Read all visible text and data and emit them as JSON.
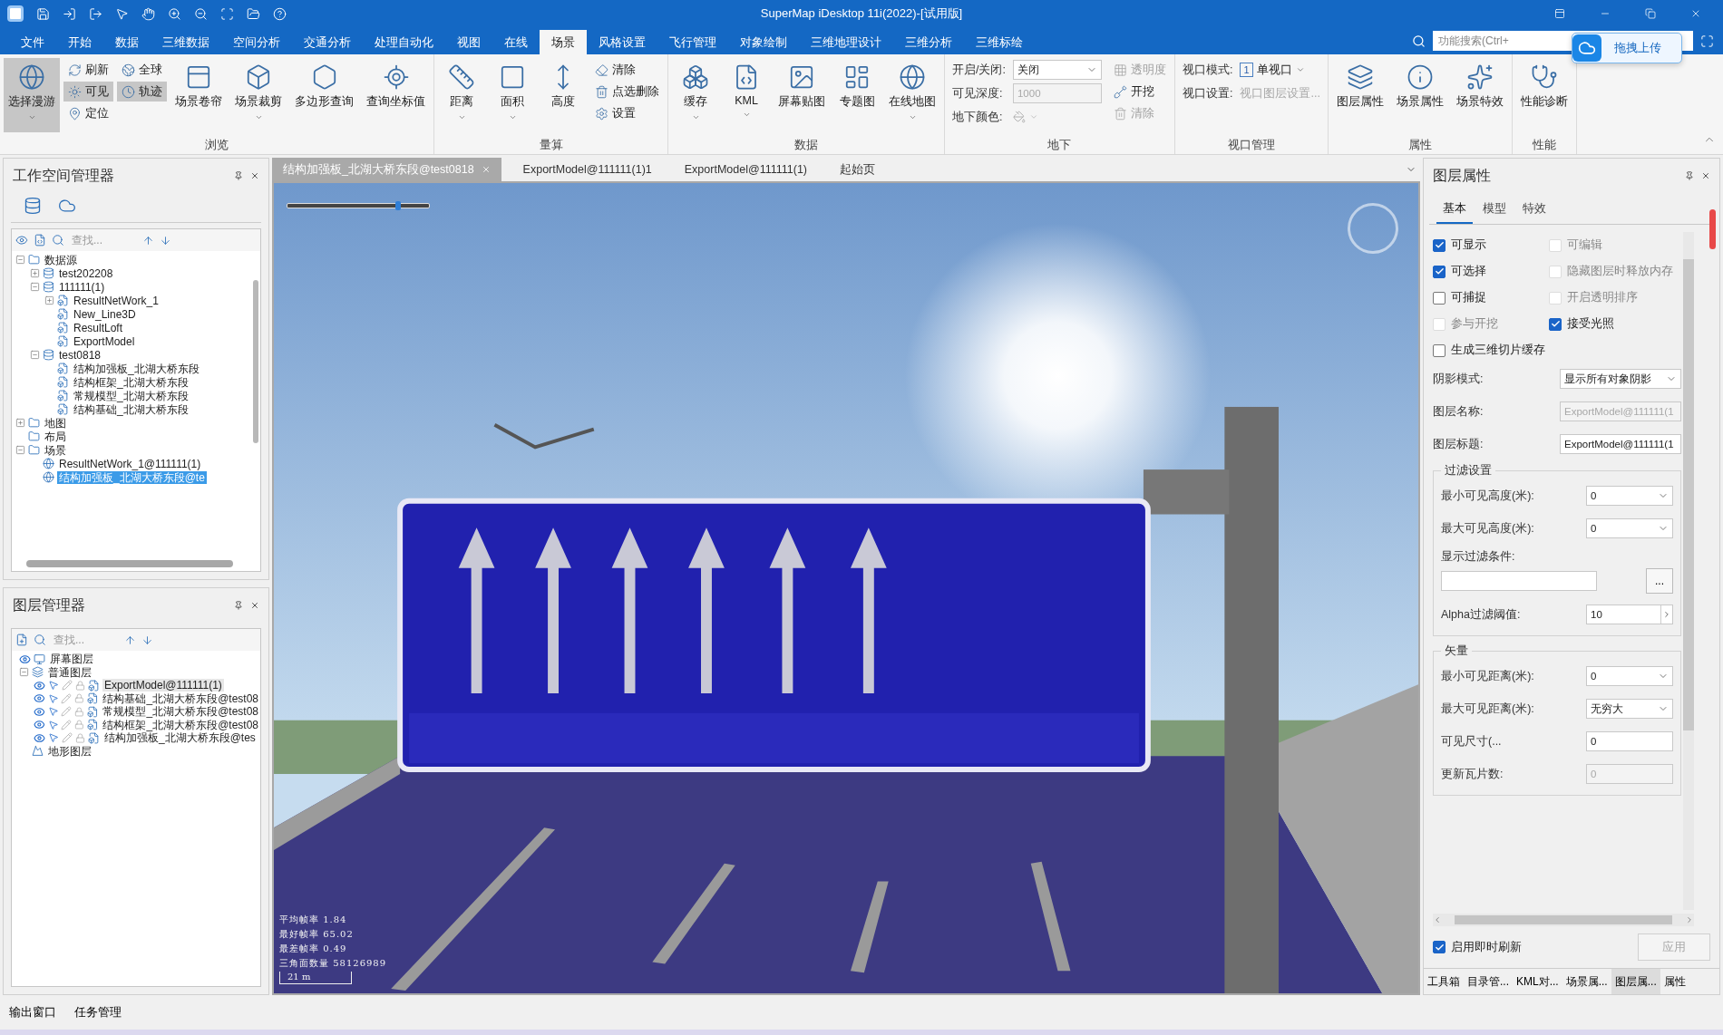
{
  "window": {
    "title": "SuperMap iDesktop 11i(2022)-[试用版]"
  },
  "menu_tabs": [
    {
      "label": "文件",
      "selected": false
    },
    {
      "label": "开始",
      "selected": false
    },
    {
      "label": "数据",
      "selected": false
    },
    {
      "label": "三维数据",
      "selected": false
    },
    {
      "label": "空间分析",
      "selected": false
    },
    {
      "label": "交通分析",
      "selected": false
    },
    {
      "label": "处理自动化",
      "selected": false
    },
    {
      "label": "视图",
      "selected": false
    },
    {
      "label": "在线",
      "selected": false
    },
    {
      "label": "场景",
      "selected": true
    },
    {
      "label": "风格设置",
      "selected": false
    },
    {
      "label": "飞行管理",
      "selected": false
    },
    {
      "label": "对象绘制",
      "selected": false
    },
    {
      "label": "三维地理设计",
      "selected": false
    },
    {
      "label": "三维分析",
      "selected": false
    },
    {
      "label": "三维标绘",
      "selected": false
    }
  ],
  "search": {
    "placeholder": "功能搜索(Ctrl+"
  },
  "upload_popup": {
    "label": "拖拽上传"
  },
  "ribbon": [
    {
      "label": "浏览",
      "items": [
        {
          "kind": "large",
          "label": "选择漫游",
          "highlighted": true,
          "dropdown": true
        },
        {
          "kind": "stack",
          "items": [
            {
              "label": "刷新",
              "highlighted": false,
              "disabled": false
            },
            {
              "label": "可见",
              "highlighted": true,
              "disabled": false
            },
            {
              "label": "定位",
              "highlighted": false,
              "disabled": false
            }
          ]
        },
        {
          "kind": "stack",
          "items": [
            {
              "label": "全球",
              "highlighted": false,
              "disabled": false
            },
            {
              "label": "轨迹",
              "highlighted": true,
              "disabled": false
            }
          ]
        },
        {
          "kind": "large",
          "label": "场景卷帘",
          "highlighted": false,
          "dropdown": false
        },
        {
          "kind": "large",
          "label": "场景裁剪",
          "highlighted": false,
          "dropdown": true
        },
        {
          "kind": "large",
          "label": "多边形查询",
          "highlighted": false,
          "dropdown": false
        },
        {
          "kind": "large",
          "label": "查询坐标值",
          "highlighted": false,
          "dropdown": false
        }
      ]
    },
    {
      "label": "量算",
      "items": [
        {
          "kind": "large",
          "label": "距离",
          "highlighted": false,
          "dropdown": true
        },
        {
          "kind": "large",
          "label": "面积",
          "highlighted": false,
          "dropdown": true
        },
        {
          "kind": "large",
          "label": "高度",
          "highlighted": false,
          "dropdown": false
        },
        {
          "kind": "stack",
          "items": [
            {
              "label": "清除",
              "highlighted": false,
              "disabled": false
            },
            {
              "label": "点选删除",
              "highlighted": false,
              "disabled": false
            },
            {
              "label": "设置",
              "highlighted": false,
              "disabled": false
            }
          ]
        }
      ]
    },
    {
      "label": "数据",
      "items": [
        {
          "kind": "large",
          "label": "缓存",
          "highlighted": false,
          "dropdown": true
        },
        {
          "kind": "large",
          "label": "KML",
          "highlighted": false,
          "dropdown": true
        },
        {
          "kind": "large",
          "label": "屏幕贴图",
          "highlighted": false,
          "dropdown": false
        },
        {
          "kind": "large",
          "label": "专题图",
          "highlighted": false,
          "dropdown": false
        },
        {
          "kind": "large",
          "label": "在线地图",
          "highlighted": false,
          "dropdown": true
        }
      ]
    },
    {
      "label": "地下",
      "items": [
        {
          "kind": "fields",
          "rows": [
            {
              "label": "开启/关闭:",
              "kind": "select",
              "value": "关闭",
              "disabled": false
            },
            {
              "label": "可见深度:",
              "kind": "input",
              "value": "1000",
              "disabled": true
            },
            {
              "label": "地下颜色:",
              "kind": "color",
              "disabled": true
            }
          ]
        },
        {
          "kind": "stack",
          "items": [
            {
              "label": "透明度",
              "highlighted": false,
              "disabled": true
            },
            {
              "label": "开挖",
              "highlighted": false,
              "disabled": false
            },
            {
              "label": "清除",
              "highlighted": false,
              "disabled": true
            }
          ]
        }
      ]
    },
    {
      "label": "视口管理",
      "items": [
        {
          "kind": "fields",
          "rows": [
            {
              "label": "视口模式:",
              "kind": "menu",
              "badge": "1",
              "value": "单视口",
              "disabled": false
            },
            {
              "label": "视口设置:",
              "kind": "text",
              "value": "视口图层设置...",
              "disabled": true
            }
          ]
        }
      ]
    },
    {
      "label": "属性",
      "items": [
        {
          "kind": "large",
          "label": "图层属性",
          "highlighted": false,
          "dropdown": false
        },
        {
          "kind": "large",
          "label": "场景属性",
          "highlighted": false,
          "dropdown": false
        },
        {
          "kind": "large",
          "label": "场景特效",
          "highlighted": false,
          "dropdown": false
        }
      ]
    },
    {
      "label": "性能",
      "items": [
        {
          "kind": "large",
          "label": "性能诊断",
          "highlighted": false,
          "dropdown": false
        }
      ]
    }
  ],
  "workspace_manager": {
    "title": "工作空间管理器",
    "search_placeholder": "查找...",
    "tree": [
      {
        "label": "数据源",
        "expanded": true,
        "selected": false,
        "children": [
          {
            "label": "test202208",
            "expanded": false,
            "selected": false
          },
          {
            "label": "111111(1)",
            "expanded": true,
            "selected": false,
            "children": [
              {
                "label": "ResultNetWork_1",
                "expanded": false,
                "selected": false
              },
              {
                "label": "New_Line3D",
                "selected": false
              },
              {
                "label": "ResultLoft",
                "selected": false
              },
              {
                "label": "ExportModel",
                "selected": false
              }
            ]
          },
          {
            "label": "test0818",
            "expanded": true,
            "selected": false,
            "children": [
              {
                "label": "结构加强板_北湖大桥东段",
                "selected": false
              },
              {
                "label": "结构框架_北湖大桥东段",
                "selected": false
              },
              {
                "label": "常规模型_北湖大桥东段",
                "selected": false
              },
              {
                "label": "结构基础_北湖大桥东段",
                "selected": false
              }
            ]
          }
        ]
      },
      {
        "label": "地图",
        "expanded": false,
        "selected": false
      },
      {
        "label": "布局",
        "selected": false
      },
      {
        "label": "场景",
        "expanded": true,
        "selected": false,
        "children": [
          {
            "label": "ResultNetWork_1@111111(1)",
            "selected": false
          },
          {
            "label": "结构加强板_北湖大桥东段@te",
            "selected": true
          }
        ]
      }
    ]
  },
  "layer_manager": {
    "title": "图层管理器",
    "search_placeholder": "查找...",
    "tree": [
      {
        "label": "屏幕图层",
        "visible": true,
        "selected": false
      },
      {
        "label": "普通图层",
        "expanded": true,
        "selected": false,
        "children": [
          {
            "label": "ExportModel@111111(1)",
            "visible": true,
            "selected": true
          },
          {
            "label": "结构基础_北湖大桥东段@test08",
            "visible": true,
            "selected": false
          },
          {
            "label": "常规模型_北湖大桥东段@test08",
            "visible": true,
            "selected": false
          },
          {
            "label": "结构框架_北湖大桥东段@test08",
            "visible": true,
            "selected": false
          },
          {
            "label": "结构加强板_北湖大桥东段@tes",
            "visible": true,
            "selected": false
          }
        ]
      },
      {
        "label": "地形图层",
        "selected": false
      }
    ]
  },
  "doc_tabs": [
    {
      "label": "结构加强板_北湖大桥东段@test0818",
      "selected": true,
      "closable": true
    },
    {
      "label": "ExportModel@111111(1)1",
      "selected": false,
      "closable": false
    },
    {
      "label": "ExportModel@111111(1)",
      "selected": false,
      "closable": false
    },
    {
      "label": "起始页",
      "selected": false,
      "closable": false
    }
  ],
  "viewport": {
    "slider": {
      "level": 0.78
    },
    "stats": [
      "平均帧率 1.84",
      "最好帧率 65.02",
      "最差帧率 0.49",
      "三角面数量 58126989"
    ],
    "scale": "21 m"
  },
  "layer_properties": {
    "title": "图层属性",
    "tabs": [
      {
        "label": "基本",
        "selected": true
      },
      {
        "label": "模型",
        "selected": false
      },
      {
        "label": "特效",
        "selected": false
      }
    ],
    "option_rows": [
      [
        {
          "label": "可显示",
          "checked": true,
          "disabled": false
        },
        {
          "label": "可编辑",
          "checked": false,
          "disabled": true
        }
      ],
      [
        {
          "label": "可选择",
          "checked": true,
          "disabled": false
        },
        {
          "label": "隐藏图层时释放内存",
          "checked": false,
          "disabled": true
        }
      ],
      [
        {
          "label": "可捕捉",
          "checked": false,
          "disabled": false
        },
        {
          "label": "开启透明排序",
          "checked": false,
          "disabled": true
        }
      ],
      [
        {
          "label": "参与开挖",
          "checked": false,
          "disabled": true
        },
        {
          "label": "接受光照",
          "checked": true,
          "disabled": false
        }
      ],
      [
        {
          "label": "生成三维切片缓存",
          "checked": false,
          "disabled": false
        }
      ]
    ],
    "fields": [
      {
        "label": "阴影模式:",
        "kind": "select",
        "value": "显示所有对象阴影",
        "disabled": false
      },
      {
        "label": "图层名称:",
        "kind": "input",
        "value": "ExportModel@111111(1",
        "disabled": true
      },
      {
        "label": "图层标题:",
        "kind": "input",
        "value": "ExportModel@111111(1",
        "disabled": false
      }
    ],
    "groups": [
      {
        "title": "过滤设置",
        "fields": [
          {
            "label": "最小可见高度(米):",
            "kind": "select",
            "value": "0",
            "disabled": false
          },
          {
            "label": "最大可见高度(米):",
            "kind": "select",
            "value": "0",
            "disabled": false
          },
          {
            "label": "显示过滤条件:",
            "kind": "browse",
            "button_label": "...",
            "disabled": false
          },
          {
            "label": "Alpha过滤阈值:",
            "kind": "spin",
            "value": "10",
            "disabled": false
          }
        ]
      },
      {
        "title": "矢量",
        "fields": [
          {
            "label": "最小可见距离(米):",
            "kind": "select",
            "value": "0",
            "disabled": false
          },
          {
            "label": "最大可见距离(米):",
            "kind": "select",
            "value": "无穷大",
            "disabled": false
          },
          {
            "label": "可见尺寸(...",
            "kind": "input",
            "value": "0",
            "disabled": false
          },
          {
            "label": "更新瓦片数:",
            "kind": "input",
            "value": "0",
            "disabled": true
          }
        ]
      }
    ],
    "instant_refresh": {
      "label": "启用即时刷新",
      "checked": true
    },
    "apply_button": {
      "label": "应用",
      "disabled": true
    }
  },
  "right_bottom_tabs": [
    {
      "label": "工具箱",
      "selected": false
    },
    {
      "label": "目录管...",
      "selected": false
    },
    {
      "label": "KML对...",
      "selected": false
    },
    {
      "label": "场景属...",
      "selected": false
    },
    {
      "label": "图层属...",
      "selected": true
    },
    {
      "label": "属性",
      "selected": false
    }
  ],
  "status_tabs": [
    {
      "label": "输出窗口"
    },
    {
      "label": "任务管理"
    }
  ]
}
